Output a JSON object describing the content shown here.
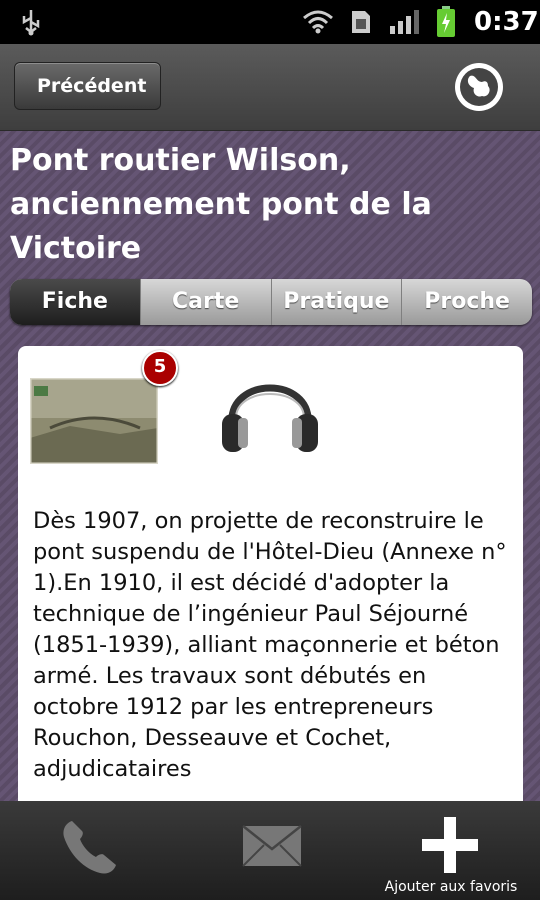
{
  "status_bar": {
    "time": "0:37",
    "icons": [
      "usb-icon",
      "wifi-icon",
      "sim-icon",
      "signal-icon",
      "battery-charging-icon"
    ]
  },
  "header": {
    "back_label": "Précédent",
    "logo_icon": "app-logo-icon"
  },
  "page": {
    "title": "Pont routier Wilson, anciennement pont de la Victoire"
  },
  "tabs": [
    {
      "label": "Fiche",
      "active": true
    },
    {
      "label": "Carte",
      "active": false
    },
    {
      "label": "Pratique",
      "active": false
    },
    {
      "label": "Proche",
      "active": false
    }
  ],
  "card": {
    "photo_count": "5",
    "description": "Dès 1907, on projette de reconstruire le pont suspendu de l'Hôtel-Dieu (Annexe n° 1).En 1910, il est décidé d'adopter la technique de l’ingénieur Paul Séjourné (1851-1939), alliant maçonnerie et béton armé. Les travaux sont débutés en octobre 1912 par les entrepreneurs Rouchon, Desseauve et Cochet, adjudicataires"
  },
  "bottom_bar": {
    "favorites_label": "Ajouter aux favoris"
  },
  "colors": {
    "background_stripe": "#5a4b66",
    "badge": "#aa0000"
  }
}
